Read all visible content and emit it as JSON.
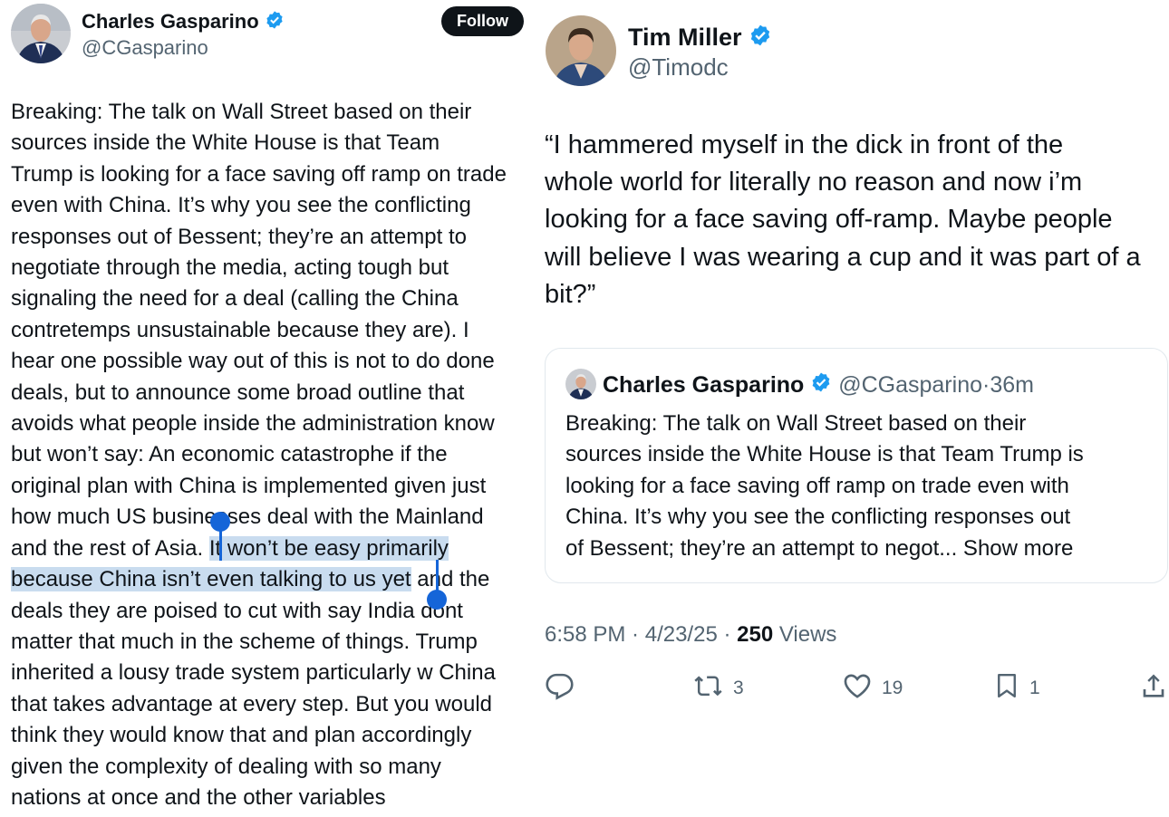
{
  "left": {
    "name": "Charles Gasparino",
    "handle": "@CGasparino",
    "follow_label": "Follow",
    "text_before": "Breaking: The talk on Wall Street based on their\nsources inside the White House is that Team\nTrump is looking for a face saving off ramp on trade\neven with China. It’s why you see the conflicting\nresponses out of Bessent; they’re an attempt to\nnegotiate through the media, acting tough but\nsignaling the need for a deal (calling the China\ncontretemps unsustainable because they are). I\nhear one possible way out of this is not to do done\ndeals, but to announce some broad outline that\navoids what people inside the administration know\nbut won’t say: An economic catastrophe if the\noriginal plan with China is implemented given just\nhow much US businesses deal with the Mainland\nand the rest of Asia. ",
    "text_selected": "It won’t be easy primarily\nbecause China isn’t even talking to us yet",
    "text_after": " and the\ndeals they are poised to cut with say India dont\nmatter that much in the scheme of things. Trump\ninherited a lousy trade system particularly w China\nthat takes advantage at every step. But you would\nthink they would know that and plan accordingly\ngiven the complexity of dealing with so many\nnations at once and the other variables"
  },
  "right": {
    "name": "Tim Miller",
    "handle": "@Timodc",
    "text": "“I hammered myself in the dick in front of the\nwhole world for literally no reason and now i’m\nlooking for a face saving off-ramp. Maybe people\nwill believe I was wearing a cup and it was part of a\nbit?”",
    "quote": {
      "name": "Charles Gasparino",
      "handle": "@CGasparino",
      "sep": "·",
      "time": "36m",
      "text": "Breaking: The talk on Wall Street based on their\nsources inside the White House is that Team Trump is\nlooking for a face saving off ramp on trade even with\nChina. It’s why you see the conflicting responses out\nof Bessent; they’re an attempt to negot...",
      "show_more": " Show more"
    },
    "meta": {
      "time": "6:58 PM",
      "sep1": " · ",
      "date": "4/23/25",
      "sep2": " · ",
      "views_count": "250",
      "views_label": " Views"
    },
    "actions": {
      "reply_icon": "reply-icon",
      "retweets": "3",
      "likes": "19",
      "bookmarks": "1",
      "share_icon": "share-icon"
    }
  },
  "colors": {
    "verified": "#1d9bf0",
    "selection": "#c9dcef",
    "handle_text": "#1565d8",
    "secondary": "#536471"
  }
}
